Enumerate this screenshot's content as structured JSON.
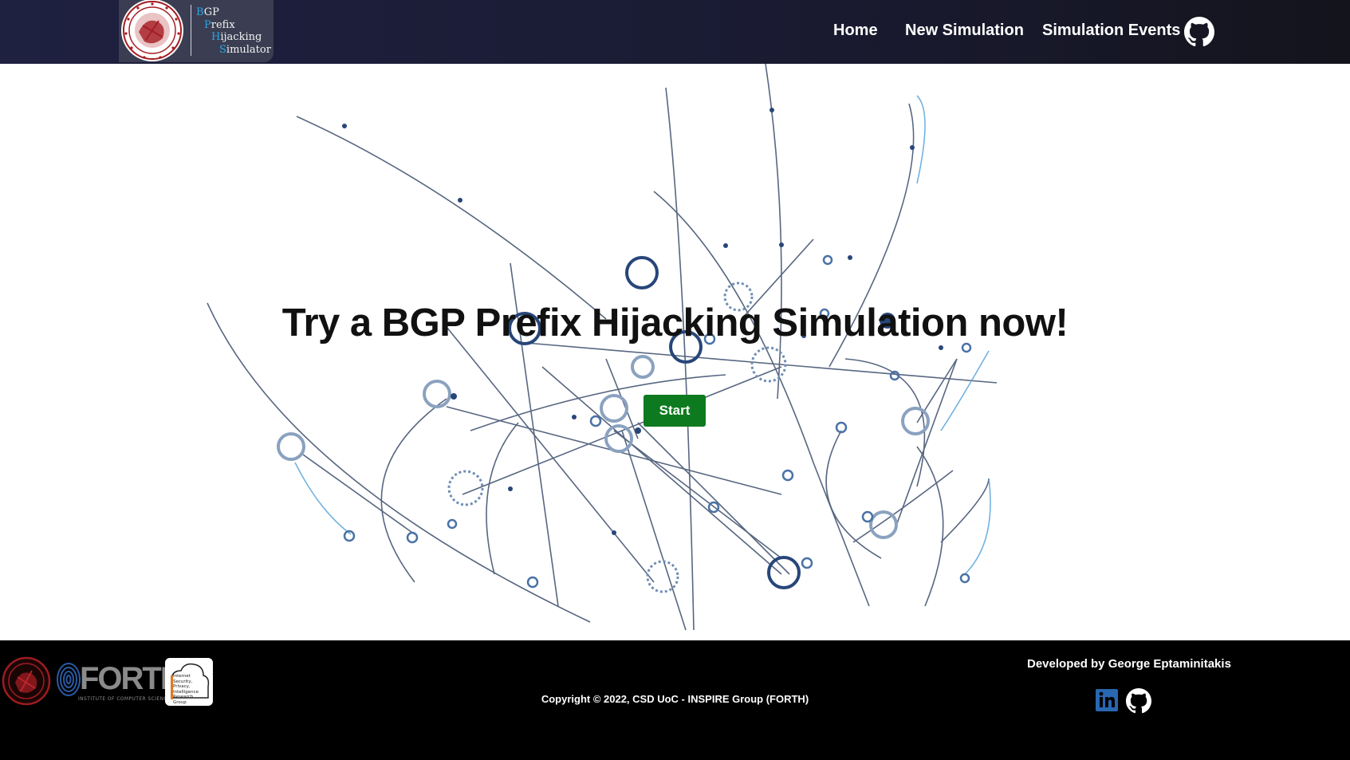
{
  "brand": {
    "lines": [
      {
        "cap": "B",
        "rest": "GP"
      },
      {
        "cap": "P",
        "rest": "refix"
      },
      {
        "cap": "H",
        "rest": "ijacking"
      },
      {
        "cap": "S",
        "rest": "imulator"
      }
    ],
    "accent_color": "#2aa6e6"
  },
  "nav": {
    "links": [
      {
        "label": "Home"
      },
      {
        "label": "New Simulation"
      },
      {
        "label": "Simulation Events"
      }
    ],
    "github_icon": "github-icon"
  },
  "hero": {
    "title": "Try a BGP Prefix Hijacking Simulation now!",
    "start_label": "Start",
    "button_color": "#0d7a1f"
  },
  "footer": {
    "logos": {
      "forth_text": "FORTH",
      "forth_sub": "INSTITUTE OF COMPUTER SCIENCE",
      "inspire_lines": [
        "Internet",
        "Security,",
        "Privacy,",
        "Intelligence",
        "Research",
        "Group"
      ]
    },
    "copyright": "Copyright © 2022, CSD UoC - INSPIRE Group (FORTH)",
    "developer": "Developed by George Eptaminitakis",
    "social_icons": [
      "linkedin-icon",
      "github-icon"
    ]
  }
}
